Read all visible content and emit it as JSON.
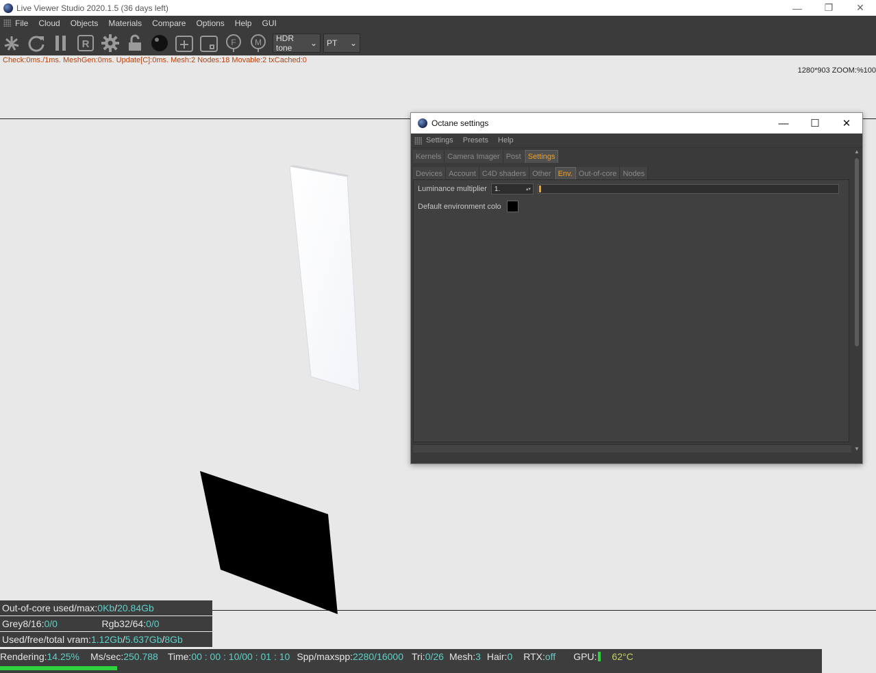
{
  "window": {
    "title": "Live Viewer Studio 2020.1.5 (36 days left)",
    "controls": [
      "—",
      "❐",
      "✕"
    ]
  },
  "menubar": [
    "File",
    "Cloud",
    "Objects",
    "Materials",
    "Compare",
    "Options",
    "Help",
    "GUI"
  ],
  "toolbar": {
    "icons": [
      "render-reset-icon",
      "refresh-icon",
      "pause-icon",
      "r-region-icon",
      "settings-gear-icon",
      "lock-icon",
      "material-sphere-icon",
      "add-region-icon",
      "focus-region-icon",
      "focus-pick-icon",
      "material-pick-icon"
    ],
    "tone_select": "HDR tone",
    "kernel_select": "PT"
  },
  "status_line": "Check:0ms./1ms. MeshGen:0ms. Update[C]:0ms. Mesh:2 Nodes:18 Movable:2 txCached:0",
  "zoom_info": "1280*903 ZOOM:%100",
  "octane": {
    "title": "Octane settings",
    "controls": [
      "—",
      "☐",
      "✕"
    ],
    "menu": [
      "Settings",
      "Presets",
      "Help"
    ],
    "tabs_top": [
      "Kernels",
      "Camera Imager",
      "Post",
      "Settings"
    ],
    "active_top": "Settings",
    "tabs_sub": [
      "Devices",
      "Account",
      "C4D shaders",
      "Other",
      "Env.",
      "Out-of-core",
      "Nodes"
    ],
    "active_sub": "Env.",
    "luminance_label": "Luminance multiplier",
    "luminance_value": "1.",
    "luminance_slider_level": 0,
    "env_color_label": "Default environment colo",
    "env_color": "#000000"
  },
  "overlay": {
    "ooc_label": "Out-of-core used/max:",
    "ooc_used": "0Kb",
    "ooc_sep": "/",
    "ooc_max": "20.84Gb",
    "grey_label": "Grey8/16: ",
    "grey_value": "0/0",
    "rgb_label": "Rgb32/64: ",
    "rgb_value": "0/0",
    "vram_label": "Used/free/total vram: ",
    "vram_used": "1.12Gb",
    "vram_free": "5.637Gb",
    "vram_total": "8Gb",
    "sep": "/"
  },
  "render": {
    "rendering_label": "Rendering: ",
    "rendering_pct": "14.25%",
    "ms_label": "Ms/sec: ",
    "ms_value": "250.788",
    "time_label": "Time: ",
    "time_value": "00 : 00 : 10/00 : 01 : 10",
    "spp_label": "Spp/maxspp: ",
    "spp_value": "2280/16000",
    "tri_label": "Tri: ",
    "tri_value": "0/26",
    "mesh_label": "Mesh: ",
    "mesh_value": "3",
    "hair_label": "Hair: ",
    "hair_value": "0",
    "rtx_label": "RTX:",
    "rtx_value": "off",
    "gpu_label": "GPU:",
    "gpu_temp": "62°C",
    "progress": 0.1425
  },
  "colors": {
    "accent": "#f0a21e",
    "value_cyan": "#5fd0c8",
    "progress_green": "#2fd13f",
    "status_text": "#b8420c"
  }
}
